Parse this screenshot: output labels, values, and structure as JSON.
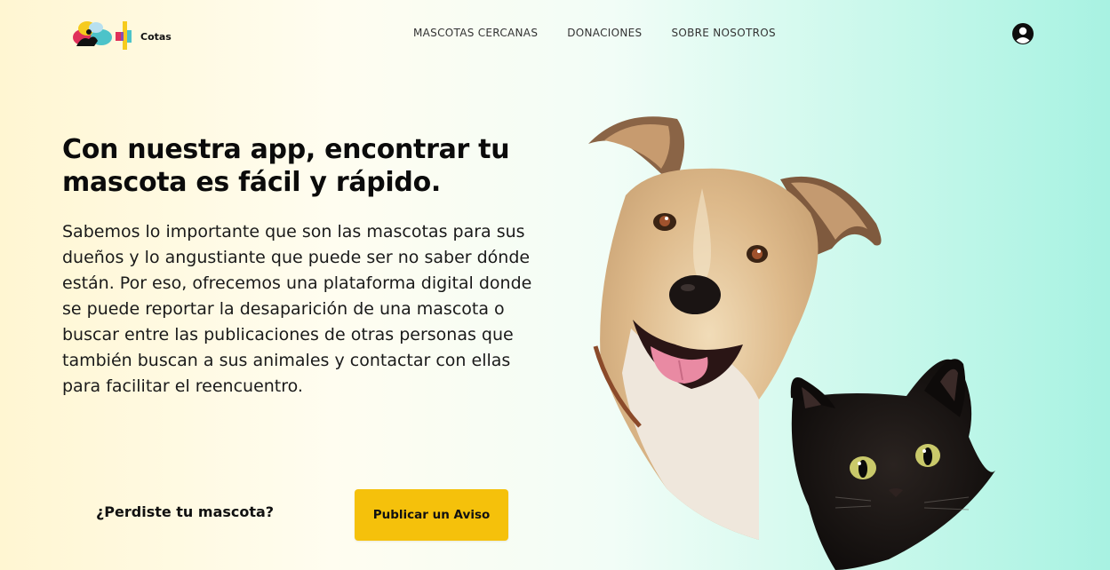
{
  "header": {
    "logo_text": "Cotas",
    "nav": [
      {
        "label": "MASCOTAS CERCANAS"
      },
      {
        "label": "DONACIONES"
      },
      {
        "label": "SOBRE NOSOTROS"
      }
    ],
    "user_icon": "user-circle-icon"
  },
  "hero": {
    "headline": "Con nuestra app, encontrar tu mascota es fácil y rápido.",
    "body": "Sabemos lo importante que son las mascotas para sus dueños y lo angustiante que puede ser no saber dónde están. Por eso, ofrecemos una plataforma digital donde se puede reportar la desaparición de una mascota o buscar entre las publicaciones de otras personas que también buscan a sus animales y contactar con ellas para facilitar el reencuentro.",
    "cta_question": "¿Perdiste tu mascota?",
    "cta_button": "Publicar un Aviso"
  },
  "colors": {
    "accent": "#f5c10b",
    "background_left": "#fff6d2",
    "background_right": "#a8f2e2"
  }
}
